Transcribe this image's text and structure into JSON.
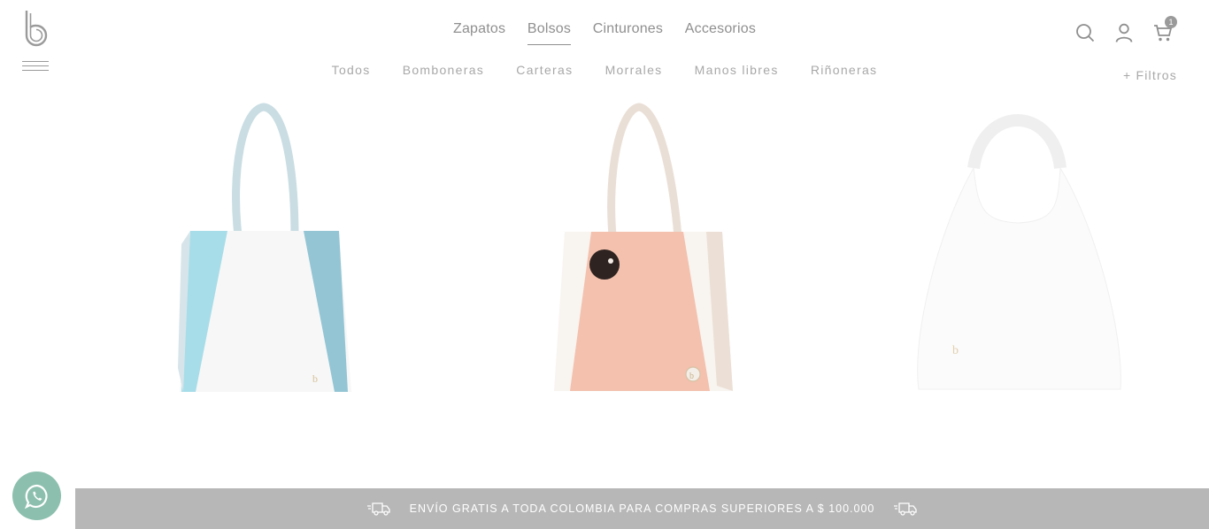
{
  "header": {
    "logo_icon": "brand-b-logo-icon",
    "menu_icon": "hamburger-menu-icon",
    "main_nav": [
      {
        "label": "Zapatos",
        "active": false
      },
      {
        "label": "Bolsos",
        "active": true
      },
      {
        "label": "Cinturones",
        "active": false
      },
      {
        "label": "Accesorios",
        "active": false
      }
    ],
    "sub_nav": [
      "Todos",
      "Bomboneras",
      "Carteras",
      "Morrales",
      "Manos libres",
      "Riñoneras"
    ],
    "filters_label": "+ Filtros",
    "icons": {
      "search": "search-icon",
      "account": "user-icon",
      "cart": "cart-icon"
    },
    "cart_count": "1"
  },
  "products": [
    {
      "name": "tote-blue-white",
      "colors": [
        "#a6dce8",
        "#f6f6f6",
        "#8fc3d2"
      ]
    },
    {
      "name": "tote-pink-white",
      "colors": [
        "#f3c0ad",
        "#f8f3ef",
        "#efe0d6"
      ]
    },
    {
      "name": "hobo-white",
      "colors": [
        "#fbfbfb"
      ]
    }
  ],
  "whatsapp": {
    "icon": "whatsapp-icon",
    "color": "#8cbfae"
  },
  "promo": {
    "text": "ENVÍO GRATIS A TODA COLOMBIA PARA COMPRAS SUPERIORES A $ 100.000",
    "icon": "delivery-truck-icon",
    "background": "#b7b7b7"
  }
}
